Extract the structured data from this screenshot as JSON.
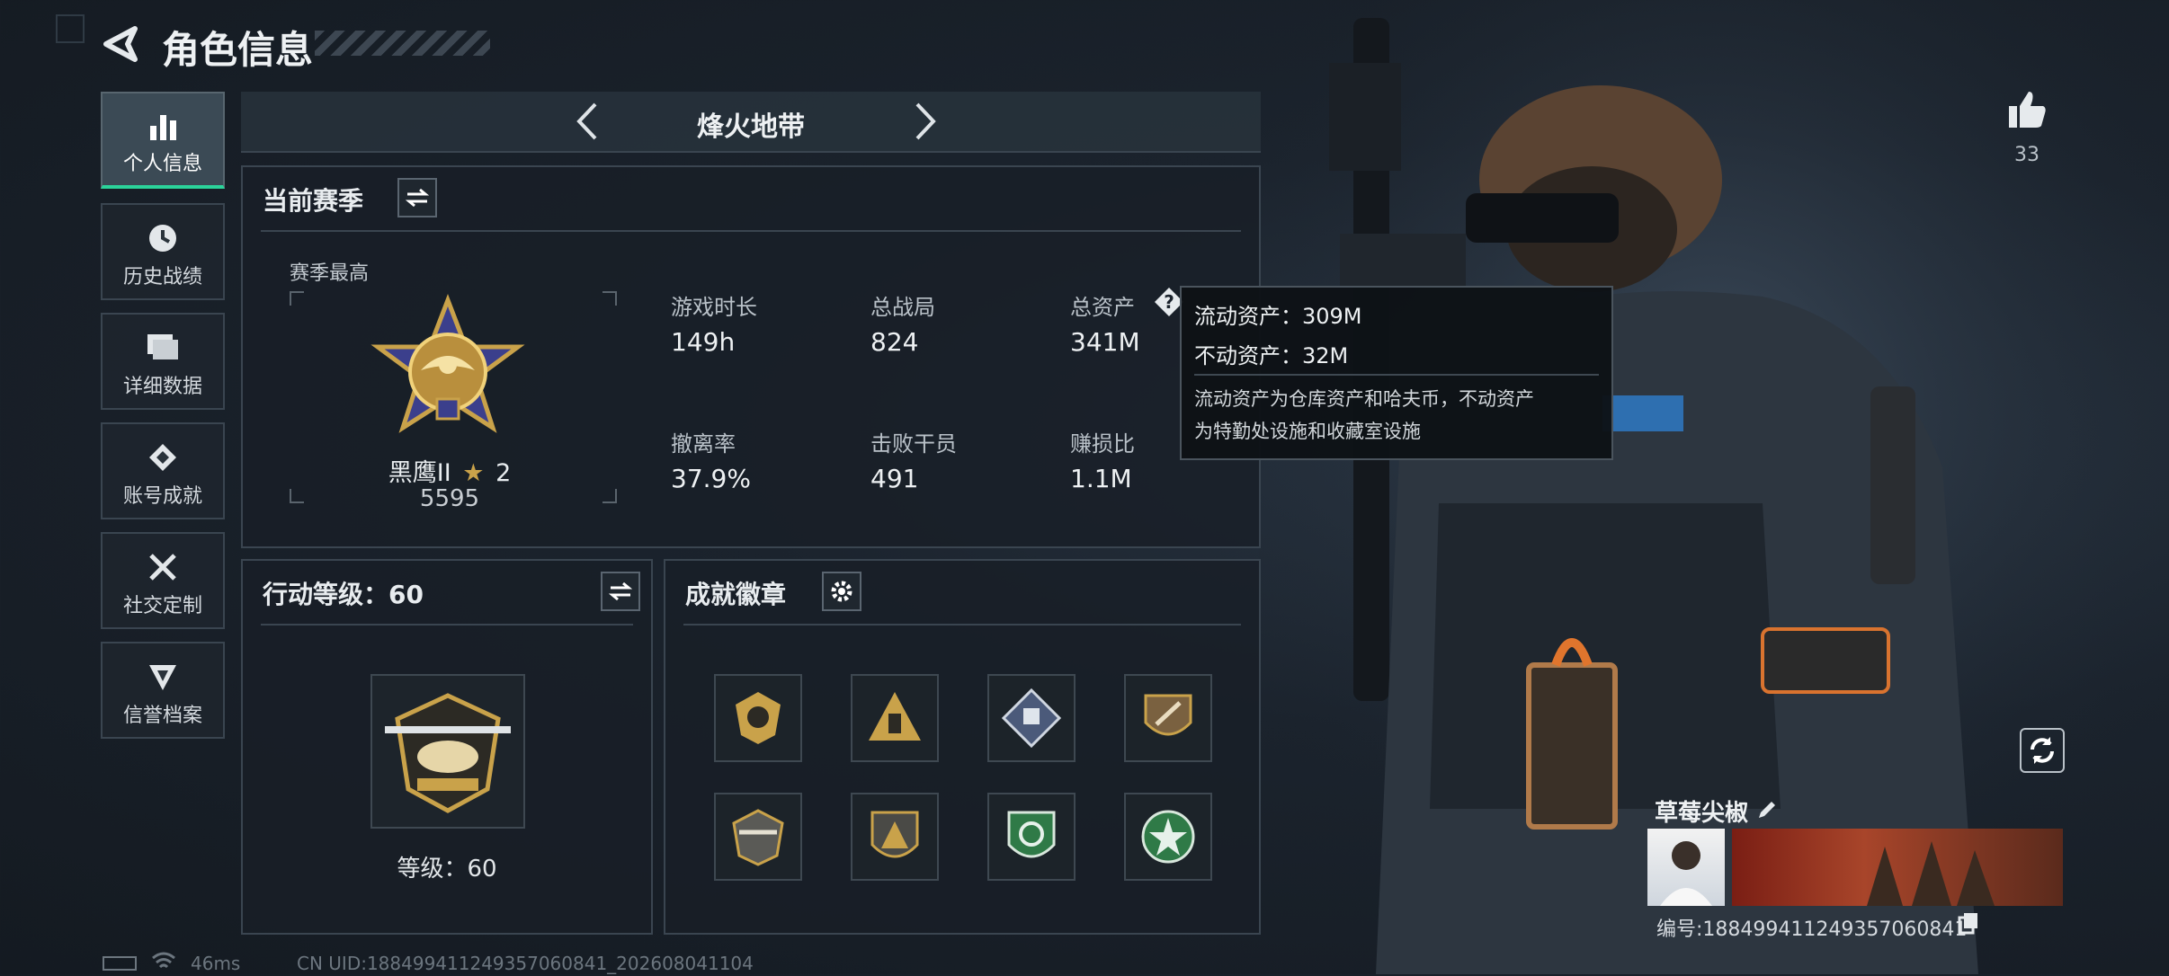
{
  "header": {
    "title": "角色信息"
  },
  "sidebar": {
    "items": [
      {
        "label": "个人信息",
        "icon": "bar-chart-icon"
      },
      {
        "label": "历史战绩",
        "icon": "history-icon"
      },
      {
        "label": "详细数据",
        "icon": "folder-icon"
      },
      {
        "label": "账号成就",
        "icon": "achievement-icon"
      },
      {
        "label": "社交定制",
        "icon": "wrench-icon"
      },
      {
        "label": "信誉档案",
        "icon": "credit-icon"
      }
    ]
  },
  "mode": {
    "title": "烽火地带"
  },
  "season": {
    "title": "当前赛季",
    "best_label": "赛季最高",
    "rank_name": "黑鹰II",
    "rank_stars": "2",
    "rank_score": "5595",
    "stats": [
      {
        "label": "游戏时长",
        "value": "149h"
      },
      {
        "label": "总战局",
        "value": "824"
      },
      {
        "label": "总资产",
        "value": "341M"
      },
      {
        "label": "撤离率",
        "value": "37.9%"
      },
      {
        "label": "击败干员",
        "value": "491"
      },
      {
        "label": "赚损比",
        "value": "1.1M"
      }
    ]
  },
  "tooltip": {
    "liquid": "流动资产：309M",
    "fixed": "不动资产：32M",
    "desc_line1": "流动资产为仓库资产和哈夫币，不动资产",
    "desc_line2": "为特勤处设施和收藏室设施"
  },
  "action_level": {
    "title": "行动等级：60",
    "level_label": "等级：60"
  },
  "achievements": {
    "title": "成就徽章"
  },
  "likes": {
    "count": "33"
  },
  "profile": {
    "name": "草莓尖椒",
    "id_text": "编号:18849941124935706084​1"
  },
  "footer": {
    "ping": "46ms",
    "uid": "CN UID:18849941124935706084​1_202608041104"
  },
  "colors": {
    "accent": "#2bd39a",
    "gold": "#c9a24a",
    "panel_border": "#3a4550"
  }
}
